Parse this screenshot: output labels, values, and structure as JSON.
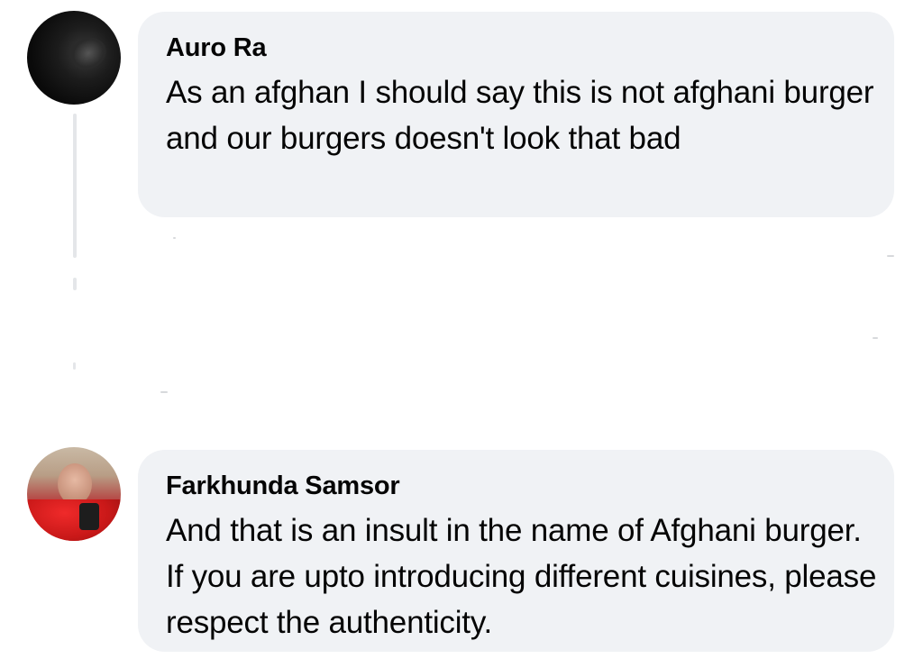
{
  "comments": [
    {
      "author": "Auro Ra",
      "text": "As an afghan I should say this is not afghani burger and our burgers doesn't look that bad"
    },
    {
      "author": "Farkhunda Samsor",
      "text": "And that is an insult in the name of Afghani burger. If you are upto introducing different cuisines, please respect the authenticity."
    }
  ],
  "colors": {
    "bubble_background": "#f0f2f5",
    "text": "#050505",
    "thread_line": "#e4e6e9"
  }
}
